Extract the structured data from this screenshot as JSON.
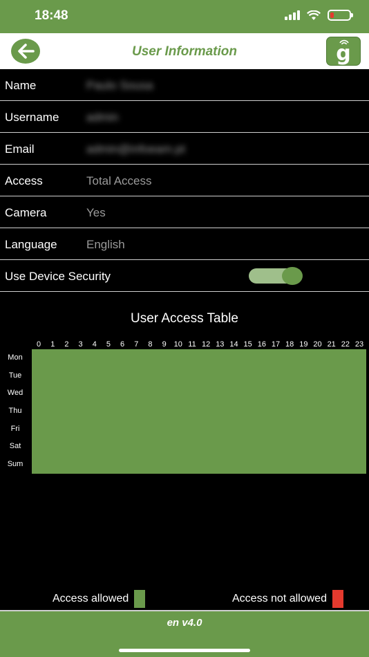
{
  "status_bar": {
    "time": "18:48",
    "battery_color": "#e53a2e"
  },
  "header": {
    "title": "User Information",
    "back_icon": "arrow-left-icon",
    "logo_letter": "g"
  },
  "fields": [
    {
      "label": "Name",
      "value": "Paulo Sousa"
    },
    {
      "label": "Username",
      "value": "admin"
    },
    {
      "label": "Email",
      "value": "admin@infoeam.pt"
    },
    {
      "label": "Access",
      "value": "Total Access"
    },
    {
      "label": "Camera",
      "value": "Yes"
    },
    {
      "label": "Language",
      "value": "English"
    },
    {
      "label": "Use Device Security",
      "toggle_on": true
    }
  ],
  "access_table": {
    "title": "User Access Table",
    "hours": [
      "0",
      "1",
      "2",
      "3",
      "4",
      "5",
      "6",
      "7",
      "8",
      "9",
      "10",
      "11",
      "12",
      "13",
      "14",
      "15",
      "16",
      "17",
      "18",
      "19",
      "20",
      "21",
      "22",
      "23"
    ],
    "days": [
      "Mon",
      "Tue",
      "Wed",
      "Thu",
      "Fri",
      "Sat",
      "Sum"
    ],
    "allowed_color": "#6a9a4b",
    "not_allowed_color": "#e53a2e"
  },
  "legend": {
    "allowed": "Access allowed",
    "not_allowed": "Access not allowed"
  },
  "footer": {
    "version": "en v4.0"
  },
  "colors": {
    "accent": "#6a9a4b"
  }
}
